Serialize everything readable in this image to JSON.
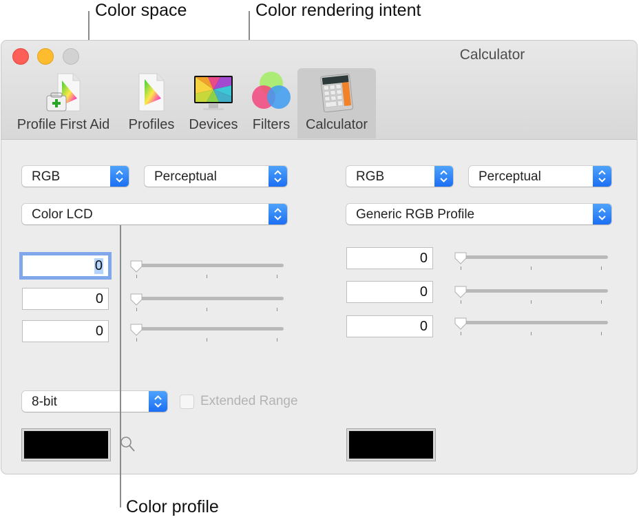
{
  "callouts": {
    "color_space": "Color space",
    "rendering_intent": "Color rendering intent",
    "color_profile": "Color profile"
  },
  "window": {
    "title": "Calculator",
    "traffic_lights": [
      "close",
      "minimize",
      "zoom"
    ]
  },
  "toolbar": {
    "items": [
      {
        "label": "Profile First Aid",
        "icon": "profile-first-aid-icon",
        "active": false
      },
      {
        "label": "Profiles",
        "icon": "profiles-icon",
        "active": false
      },
      {
        "label": "Devices",
        "icon": "devices-icon",
        "active": false
      },
      {
        "label": "Filters",
        "icon": "filters-icon",
        "active": false
      },
      {
        "label": "Calculator",
        "icon": "calculator-icon",
        "active": true
      }
    ]
  },
  "left_panel": {
    "color_space": "RGB",
    "rendering_intent": "Perceptual",
    "profile": "Color LCD",
    "channels": [
      {
        "value": "0",
        "slider_fraction": 0,
        "focused": true
      },
      {
        "value": "0",
        "slider_fraction": 0,
        "focused": false
      },
      {
        "value": "0",
        "slider_fraction": 0,
        "focused": false
      }
    ],
    "bit_depth": "8-bit",
    "extended_range_label": "Extended Range",
    "extended_range_checked": false,
    "swatch_color": "#000000"
  },
  "right_panel": {
    "color_space": "RGB",
    "rendering_intent": "Perceptual",
    "profile": "Generic RGB Profile",
    "channels": [
      {
        "value": "0",
        "slider_fraction": 0
      },
      {
        "value": "0",
        "slider_fraction": 0
      },
      {
        "value": "0",
        "slider_fraction": 0
      }
    ],
    "swatch_color": "#000000"
  },
  "colors": {
    "accent": "#1c6ff3",
    "close": "#fc5f57",
    "minimize": "#fdbc2e"
  }
}
